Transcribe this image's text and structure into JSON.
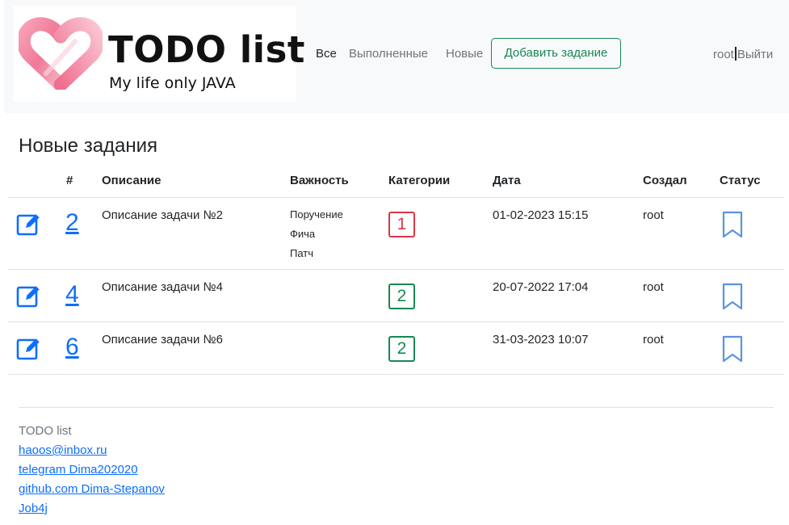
{
  "brand": {
    "title": "TODO list",
    "subtitle": "My life only JAVA",
    "heart_icon": "heart-logo-icon",
    "heart_color": "#f48ba4"
  },
  "nav": {
    "all": "Все",
    "done": "Выполненные",
    "new": "Новые",
    "add_task": "Добавить задание",
    "user": "root",
    "logout": "Выйти"
  },
  "page": {
    "title": "Новые задания"
  },
  "table": {
    "headers": {
      "id": "#",
      "description": "Описание",
      "priority": "Важность",
      "categories": "Категории",
      "date": "Дата",
      "creator": "Создал",
      "status": "Статус"
    },
    "rows": [
      {
        "id": "2",
        "description": "Описание задачи №2",
        "priorities": [
          "Поручение",
          "Фича",
          "Патч"
        ],
        "category": "1",
        "category_color": "#dc3545",
        "date": "01-02-2023 15:15",
        "creator": "root",
        "edit_icon": "edit-icon",
        "status_icon": "bookmark-icon"
      },
      {
        "id": "4",
        "description": "Описание задачи №4",
        "priorities": [],
        "category": "2",
        "category_color": "#198754",
        "date": "20-07-2022 17:04",
        "creator": "root",
        "edit_icon": "edit-icon",
        "status_icon": "bookmark-icon"
      },
      {
        "id": "6",
        "description": "Описание задачи №6",
        "priorities": [],
        "category": "2",
        "category_color": "#198754",
        "date": "31-03-2023 10:07",
        "creator": "root",
        "edit_icon": "edit-icon",
        "status_icon": "bookmark-icon"
      }
    ]
  },
  "footer": {
    "title": "TODO list",
    "links": [
      "haoos@inbox.ru",
      "telegram Dima202020",
      "github.com Dima-Stepanov",
      "Job4j"
    ]
  },
  "colors": {
    "accent": "#0d6efd",
    "success": "#198754",
    "danger": "#dc3545",
    "navbar_bg": "#f8f9fa"
  }
}
